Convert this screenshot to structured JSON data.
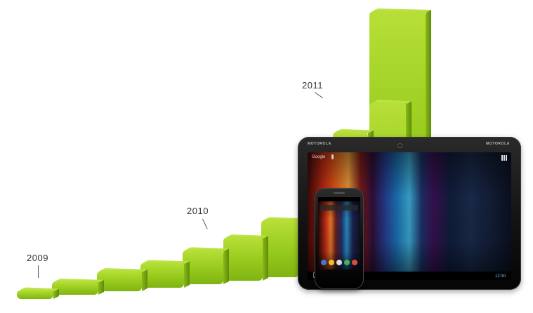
{
  "chart_data": {
    "type": "bar",
    "title": "",
    "xlabel": "",
    "ylabel": "",
    "annotations": [
      "2009",
      "2010",
      "2011"
    ],
    "values": [
      5,
      7,
      10,
      12,
      16,
      20,
      26,
      49,
      61,
      72,
      110
    ],
    "bar_color": "#8cc21d",
    "bar_color_top": "#b4e03c",
    "bar_color_side": "#6c9a12",
    "grid": false,
    "legend": "none"
  },
  "labels": {
    "year_2009": "2009",
    "year_2010": "2010",
    "year_2011": "2011"
  },
  "devices": {
    "tablet_brand_left": "MOTOROLA",
    "tablet_brand_right": "MOTOROLA",
    "tablet_search_text": "Google",
    "tablet_clock": "12:30"
  }
}
